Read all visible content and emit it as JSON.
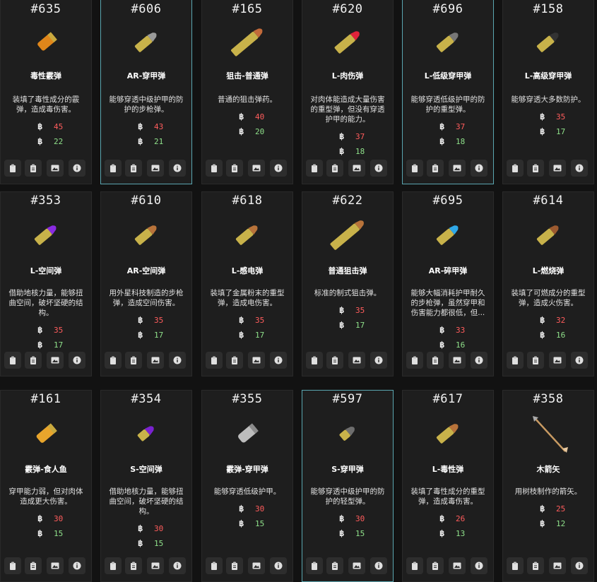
{
  "currency_symbol": "฿",
  "colors": {
    "damage": "#ff5c5c",
    "penetration": "#8fe08a",
    "selected_border": "#5aa6b0"
  },
  "cards": [
    {
      "id": "#635",
      "name": "毒性霰弹",
      "desc": "装填了毒性成分的霰弹，造成毒伤害。",
      "damage": "45",
      "pen": "22",
      "icon": "shotgun-shell-orange-icon",
      "selected": false
    },
    {
      "id": "#606",
      "name": "AR-穿甲弹",
      "desc": "能够穿透中级护甲的防护的步枪弹。",
      "damage": "43",
      "pen": "21",
      "icon": "rifle-bullet-ap-icon",
      "selected": true
    },
    {
      "id": "#165",
      "name": "狙击-普通弹",
      "desc": "普通的狙击弹药。",
      "damage": "40",
      "pen": "20",
      "icon": "sniper-bullet-icon",
      "selected": false
    },
    {
      "id": "#620",
      "name": "L-肉伤弹",
      "desc": "对肉体能造成大量伤害的重型弹，但没有穿透护甲的能力。",
      "damage": "37",
      "pen": "18",
      "icon": "heavy-bullet-red-tip-icon",
      "selected": false
    },
    {
      "id": "#696",
      "name": "L-低级穿甲弹",
      "desc": "能够穿透低级护甲的防护的重型弹。",
      "damage": "37",
      "pen": "18",
      "icon": "heavy-bullet-gray-tip-icon",
      "selected": true
    },
    {
      "id": "#158",
      "name": "L-高级穿甲弹",
      "desc": "能够穿透大多数防护。",
      "damage": "35",
      "pen": "17",
      "icon": "heavy-bullet-black-tip-icon",
      "selected": false
    },
    {
      "id": "#353",
      "name": "L-空间弹",
      "desc": "借助地核力量，能够扭曲空间，破坏坚硬的结构。",
      "damage": "35",
      "pen": "17",
      "icon": "heavy-bullet-purple-tip-icon",
      "selected": false
    },
    {
      "id": "#610",
      "name": "AR-空间弹",
      "desc": "用外星科技制造的步枪弹，造成空间伤害。",
      "damage": "35",
      "pen": "17",
      "icon": "rifle-bullet-copper-icon",
      "selected": false
    },
    {
      "id": "#618",
      "name": "L-感电弹",
      "desc": "装填了金属粉末的重型弹，造成电伤害。",
      "damage": "35",
      "pen": "17",
      "icon": "heavy-bullet-copper-icon",
      "selected": false
    },
    {
      "id": "#622",
      "name": "普通狙击弹",
      "desc": "标准的制式狙击弹。",
      "damage": "35",
      "pen": "17",
      "icon": "sniper-bullet-long-icon",
      "selected": false
    },
    {
      "id": "#695",
      "name": "AR-碎甲弹",
      "desc": "能够大幅消耗护甲耐久的步枪弹，虽然穿甲和伤害能力都很低，但...",
      "damage": "33",
      "pen": "16",
      "icon": "rifle-bullet-blue-tip-icon",
      "selected": false
    },
    {
      "id": "#614",
      "name": "L-燃烧弹",
      "desc": "装填了可燃成分的重型弹，造成火伤害。",
      "damage": "32",
      "pen": "16",
      "icon": "heavy-bullet-brown-tip-icon",
      "selected": false
    },
    {
      "id": "#161",
      "name": "霰弹-食人鱼",
      "desc": "穿甲能力弱，但对肉体造成更大伤害。",
      "damage": "30",
      "pen": "15",
      "icon": "shotgun-shell-gold-icon",
      "selected": false
    },
    {
      "id": "#354",
      "name": "S-空间弹",
      "desc": "借助地核力量，能够扭曲空间，破坏坚硬的结构。",
      "damage": "30",
      "pen": "15",
      "icon": "short-bullet-purple-icon",
      "selected": false
    },
    {
      "id": "#355",
      "name": "霰弹-穿甲弹",
      "desc": "能够穿透低级护甲。",
      "damage": "30",
      "pen": "15",
      "icon": "shotgun-slug-silver-icon",
      "selected": false
    },
    {
      "id": "#597",
      "name": "S-穿甲弹",
      "desc": "能够穿透中级护甲的防护的轻型弹。",
      "damage": "30",
      "pen": "15",
      "icon": "short-bullet-gray-icon",
      "selected": true
    },
    {
      "id": "#617",
      "name": "L-毒性弹",
      "desc": "装填了毒性成分的重型弹，造成毒伤害。",
      "damage": "26",
      "pen": "13",
      "icon": "heavy-bullet-copper-tip-icon",
      "selected": false
    },
    {
      "id": "#358",
      "name": "木箭矢",
      "desc": "用树枝制作的箭矢。",
      "damage": "25",
      "pen": "12",
      "icon": "wooden-arrow-icon",
      "selected": false
    }
  ]
}
